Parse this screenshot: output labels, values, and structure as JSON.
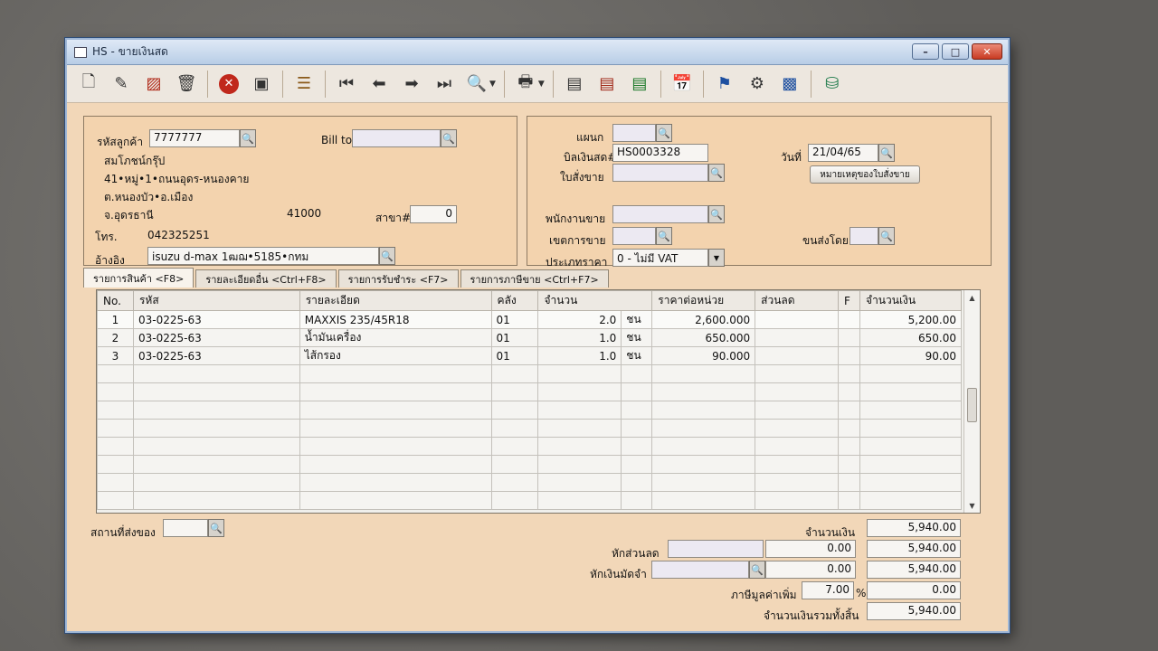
{
  "window": {
    "title": "HS - ขายเงินสด"
  },
  "toolbar": {
    "icons": [
      "new-doc-icon",
      "edit-icon",
      "delete-doc-icon",
      "trash-icon",
      "cancel-icon",
      "exit-icon",
      "stack-icon",
      "first-icon",
      "prev-icon",
      "next-icon",
      "last-icon",
      "search-doc-icon",
      "print-icon",
      "screen1-icon",
      "screen2-icon",
      "screen3-icon",
      "calendar-icon",
      "ok-user-icon",
      "ok-tool-icon",
      "ok-doc-icon",
      "db-icon"
    ]
  },
  "customer": {
    "code_label": "รหัสลูกค้า",
    "code": "7777777",
    "name": "สมโภชน์กรุ๊ป",
    "addr1": "41•หมู่•1•ถนนอุดร-หนองคาย",
    "addr2": "ต.หนองบัว•อ.เมือง",
    "addr3": "จ.อุดรธานี",
    "postcode": "41000",
    "branch_label": "สาขา#",
    "branch": "0",
    "phone_label": "โทร.",
    "phone": "042325251",
    "ref_label": "อ้างอิง",
    "ref": "isuzu d-max 1ฒฌ•5185•กทม",
    "billto_label": "Bill to"
  },
  "doc": {
    "dept_label": "แผนก",
    "billno_label": "บิลเงินสด#",
    "billno": "HS0003328",
    "date_label": "วันที่",
    "date": "21/04/65",
    "so_label": "ใบสั่งขาย",
    "so_note_button": "หมายเหตุของใบสั่งขาย",
    "salesman_label": "พนักงานขาย",
    "area_label": "เขตการขาย",
    "ship_label": "ขนส่งโดย",
    "price_type_label": "ประเภทราคา",
    "price_type": "0 - ไม่มี VAT"
  },
  "tabs": [
    {
      "label": "รายการสินค้า <F8>"
    },
    {
      "label": "รายละเอียดอื่น <Ctrl+F8>"
    },
    {
      "label": "รายการรับชำระ <F7>"
    },
    {
      "label": "รายการภาษีขาย <Ctrl+F7>"
    }
  ],
  "grid": {
    "headers": [
      "No.",
      "รหัส",
      "รายละเอียด",
      "คลัง",
      "จำนวน",
      "",
      "ราคาต่อหน่วย",
      "ส่วนลด",
      "F",
      "จำนวนเงิน"
    ],
    "rows": [
      [
        "1",
        "03-0225-63",
        "MAXXIS 235/45R18",
        "01",
        "2.0",
        "ชน",
        "2,600.000",
        "",
        "",
        "5,200.00"
      ],
      [
        "2",
        "03-0225-63",
        "น้ำมันเครื่อง",
        "01",
        "1.0",
        "ชน",
        "650.000",
        "",
        "",
        "650.00"
      ],
      [
        "3",
        "03-0225-63",
        "ไส้กรอง",
        "01",
        "1.0",
        "ชน",
        "90.000",
        "",
        "",
        "90.00"
      ]
    ]
  },
  "footer": {
    "ship_place_label": "สถานที่ส่งของ",
    "amount_label": "จำนวนเงิน",
    "amount": "5,940.00",
    "discount_label": "หักส่วนลด",
    "discount": "0.00",
    "after_discount": "5,940.00",
    "deposit_label": "หักเงินมัดจำ",
    "deposit": "0.00",
    "after_deposit": "5,940.00",
    "vat_label": "ภาษีมูลค่าเพิ่ม",
    "vat_rate": "7.00",
    "vat_pct": "%",
    "vat_amount": "0.00",
    "total_label": "จำนวนเงินรวมทั้งสิ้น",
    "total": "5,940.00"
  }
}
